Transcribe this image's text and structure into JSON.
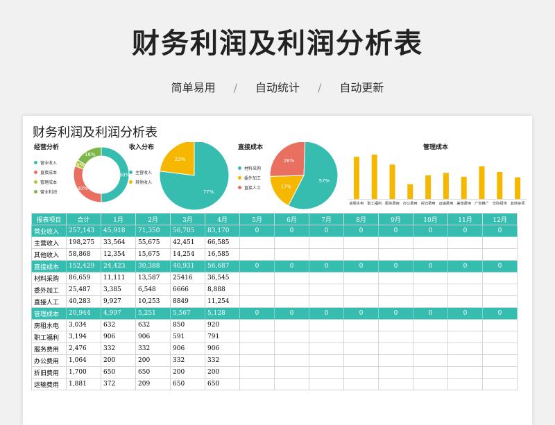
{
  "page": {
    "title": "财务利润及利润分析表",
    "subtitle": [
      "简单易用",
      "自动统计",
      "自动更新"
    ]
  },
  "sheet": {
    "title": "财务利润及利润分析表",
    "charts": {
      "operating": {
        "title": "经营分析",
        "legend": [
          "营业收入",
          "直接成本",
          "管理成本",
          "营业利润"
        ]
      },
      "income": {
        "title": "收入分布",
        "legend": [
          "主营收入",
          "其他收入"
        ]
      },
      "direct": {
        "title": "直接成本",
        "legend": [
          "材料采购",
          "委外加工",
          "直接人工"
        ]
      },
      "mgmt": {
        "title": "管理成本"
      }
    },
    "table": {
      "headers": [
        "报表项目",
        "合计",
        "1月",
        "2月",
        "3月",
        "4月",
        "5月",
        "6月",
        "7月",
        "8月",
        "9月",
        "10月",
        "11月",
        "12月"
      ],
      "rows": [
        {
          "group": true,
          "cells": [
            "营业收入",
            "257,143",
            "45,918",
            "71,350",
            "56,705",
            "83,170",
            "0",
            "0",
            "0",
            "0",
            "0",
            "0",
            "0",
            "0"
          ]
        },
        {
          "group": false,
          "cells": [
            "主营收入",
            "198,275",
            "33,564",
            "55,675",
            "42,451",
            "66,585",
            "",
            "",
            "",
            "",
            "",
            "",
            "",
            ""
          ]
        },
        {
          "group": false,
          "cells": [
            "其他收入",
            "58,868",
            "12,354",
            "15,675",
            "14,254",
            "16,585",
            "",
            "",
            "",
            "",
            "",
            "",
            "",
            ""
          ]
        },
        {
          "group": true,
          "cells": [
            "直接成本",
            "152,429",
            "24,423",
            "30,388",
            "40,931",
            "56,687",
            "0",
            "0",
            "0",
            "0",
            "0",
            "0",
            "0",
            "0"
          ]
        },
        {
          "group": false,
          "cells": [
            "材料采购",
            "86,659",
            "11,111",
            "13,587",
            "25416",
            "36,545",
            "",
            "",
            "",
            "",
            "",
            "",
            "",
            ""
          ]
        },
        {
          "group": false,
          "cells": [
            "委外加工",
            "25,487",
            "3,385",
            "6,548",
            "6666",
            "8,888",
            "",
            "",
            "",
            "",
            "",
            "",
            "",
            ""
          ]
        },
        {
          "group": false,
          "cells": [
            "直接人工",
            "40,283",
            "9,927",
            "10,253",
            "8849",
            "11,254",
            "",
            "",
            "",
            "",
            "",
            "",
            "",
            ""
          ]
        },
        {
          "group": true,
          "cells": [
            "管理成本",
            "20,944",
            "4,997",
            "5,251",
            "5,567",
            "5,128",
            "0",
            "0",
            "0",
            "0",
            "0",
            "0",
            "0",
            "0"
          ]
        },
        {
          "group": false,
          "cells": [
            "房租水电",
            "3,034",
            "632",
            "632",
            "850",
            "920",
            "",
            "",
            "",
            "",
            "",
            "",
            "",
            ""
          ]
        },
        {
          "group": false,
          "cells": [
            "职工福利",
            "3,194",
            "906",
            "906",
            "591",
            "791",
            "",
            "",
            "",
            "",
            "",
            "",
            "",
            ""
          ]
        },
        {
          "group": false,
          "cells": [
            "服务费用",
            "2,476",
            "332",
            "332",
            "906",
            "906",
            "",
            "",
            "",
            "",
            "",
            "",
            "",
            ""
          ]
        },
        {
          "group": false,
          "cells": [
            "办公费用",
            "1,064",
            "200",
            "200",
            "332",
            "332",
            "",
            "",
            "",
            "",
            "",
            "",
            "",
            ""
          ]
        },
        {
          "group": false,
          "cells": [
            "折旧费用",
            "1,700",
            "650",
            "650",
            "200",
            "200",
            "",
            "",
            "",
            "",
            "",
            "",
            "",
            ""
          ]
        },
        {
          "group": false,
          "cells": [
            "运输费用",
            "1,881",
            "372",
            "209",
            "650",
            "650",
            "",
            "",
            "",
            "",
            "",
            "",
            "",
            ""
          ]
        }
      ]
    }
  },
  "chart_data": [
    {
      "type": "pie",
      "title": "经营分析",
      "categories": [
        "营业收入",
        "直接成本",
        "管理成本",
        "营业利润"
      ],
      "values": [
        50,
        30,
        4,
        16
      ],
      "colors": [
        "#36bdb0",
        "#e96f61",
        "#a8c93b",
        "#7ab648"
      ]
    },
    {
      "type": "pie",
      "title": "收入分布",
      "categories": [
        "主营收入",
        "其他收入"
      ],
      "values": [
        77,
        23
      ],
      "colors": [
        "#36bdb0",
        "#f5b700"
      ]
    },
    {
      "type": "pie",
      "title": "直接成本",
      "categories": [
        "材料采购",
        "委外加工",
        "直接人工"
      ],
      "values": [
        57,
        17,
        26
      ],
      "colors": [
        "#36bdb0",
        "#f5b700",
        "#e96f61"
      ]
    },
    {
      "type": "bar",
      "title": "管理成本",
      "categories": [
        "房租水电",
        "职工福利",
        "服务费用",
        "办公费用",
        "折旧费用",
        "运输费用",
        "差旅费用",
        "广告推广",
        "交际招待",
        "其他杂项"
      ],
      "values": [
        3034,
        3194,
        2476,
        1064,
        1700,
        1881,
        1600,
        2350,
        1950,
        1560
      ],
      "color": "#f5b700"
    }
  ]
}
